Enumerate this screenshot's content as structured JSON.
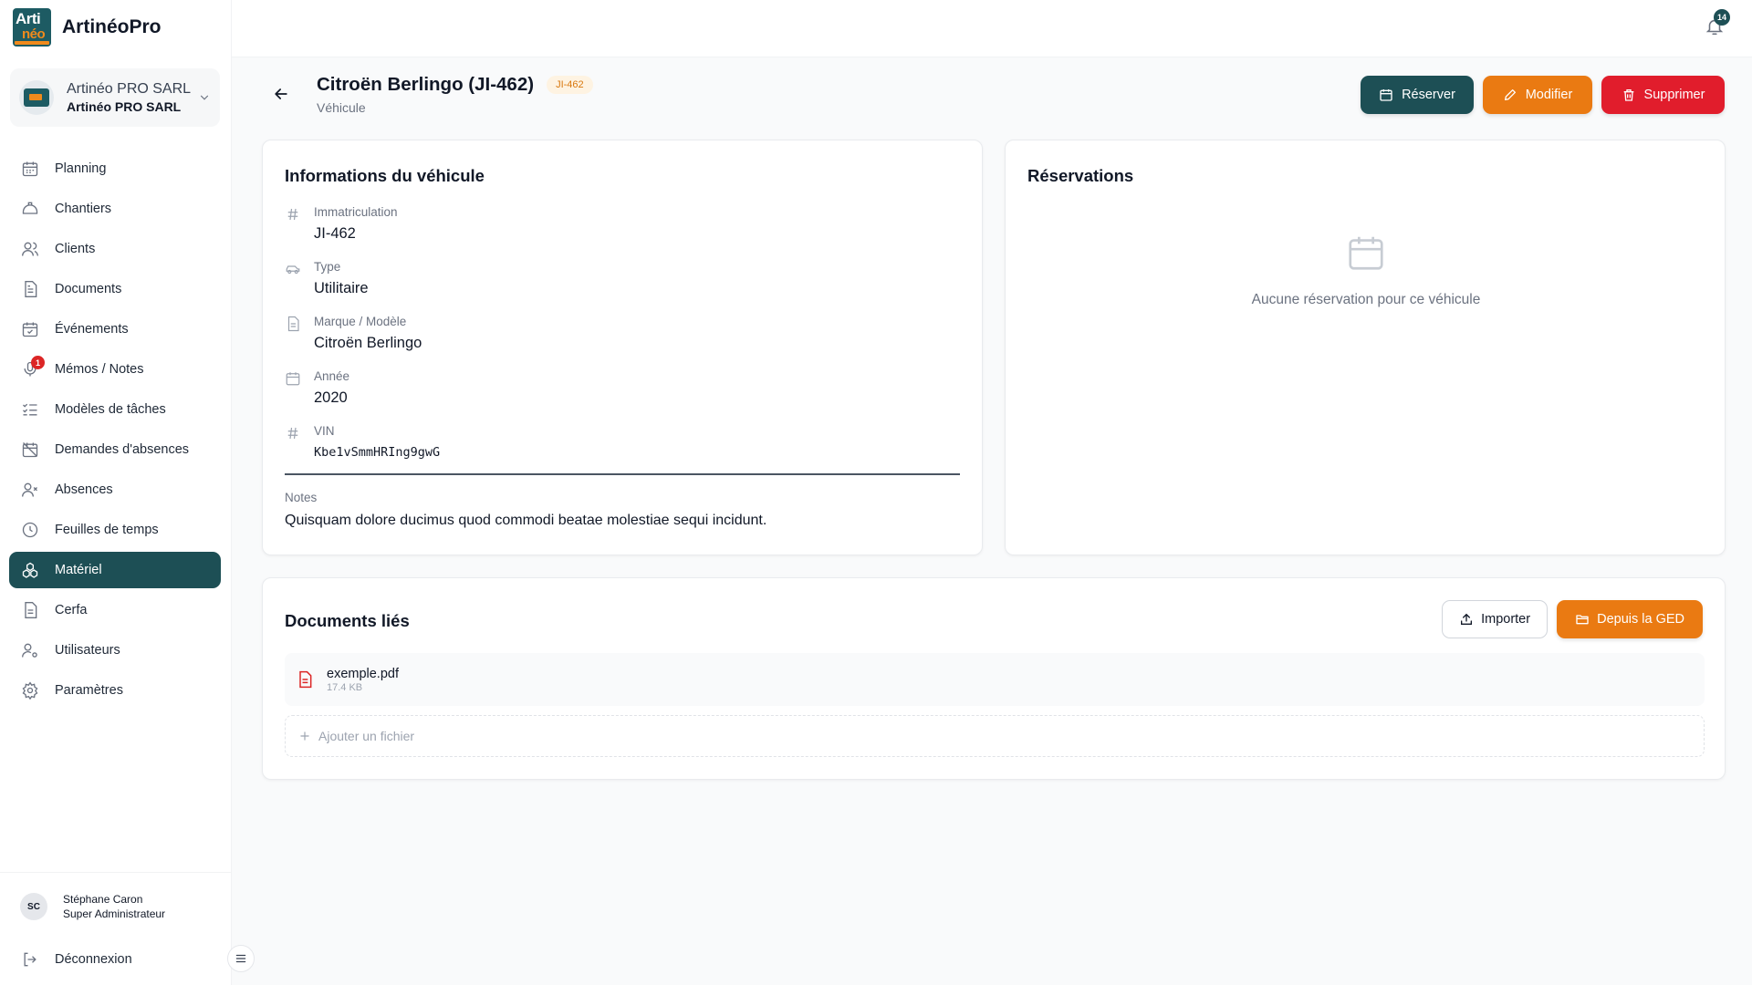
{
  "app": {
    "logo_top": "Arti",
    "logo_bottom": "néo",
    "name": "ArtinéoPro"
  },
  "company": {
    "name_top": "Artinéo PRO SARL",
    "name_bottom": "Artinéo PRO SARL"
  },
  "sidebar": {
    "items": [
      {
        "label": "Planning",
        "icon": "calendar-icon"
      },
      {
        "label": "Chantiers",
        "icon": "hard-hat-icon"
      },
      {
        "label": "Clients",
        "icon": "users-icon"
      },
      {
        "label": "Documents",
        "icon": "document-icon"
      },
      {
        "label": "Événements",
        "icon": "calendar-check-icon"
      },
      {
        "label": "Mémos / Notes",
        "icon": "microphone-icon",
        "badge": "1"
      },
      {
        "label": "Modèles de tâches",
        "icon": "list-checks-icon"
      },
      {
        "label": "Demandes d'absences",
        "icon": "calendar-off-icon"
      },
      {
        "label": "Absences",
        "icon": "user-x-icon"
      },
      {
        "label": "Feuilles de temps",
        "icon": "clock-icon"
      },
      {
        "label": "Matériel",
        "icon": "boxes-icon",
        "active": true
      },
      {
        "label": "Cerfa",
        "icon": "file-text-icon"
      },
      {
        "label": "Utilisateurs",
        "icon": "user-cog-icon"
      },
      {
        "label": "Paramètres",
        "icon": "settings-icon"
      }
    ]
  },
  "user": {
    "initials": "SC",
    "name": "Stéphane Caron",
    "role": "Super Administrateur"
  },
  "logout_label": "Déconnexion",
  "notifications": {
    "count": "14"
  },
  "page": {
    "title": "Citroën Berlingo (JI-462)",
    "badge": "JI-462",
    "subtitle": "Véhicule"
  },
  "actions": {
    "reserve": "Réserver",
    "edit": "Modifier",
    "delete": "Supprimer"
  },
  "info": {
    "title": "Informations du véhicule",
    "fields": [
      {
        "label": "Immatriculation",
        "value": "JI-462",
        "icon": "hash-icon"
      },
      {
        "label": "Type",
        "value": "Utilitaire",
        "icon": "car-icon"
      },
      {
        "label": "Marque / Modèle",
        "value": "Citroën Berlingo",
        "icon": "file-icon"
      },
      {
        "label": "Année",
        "value": "2020",
        "icon": "calendar-icon"
      },
      {
        "label": "VIN",
        "value": "Kbe1vSmmHRIng9gwG",
        "icon": "hash-icon"
      }
    ],
    "notes_label": "Notes",
    "notes_value": "Quisquam dolore ducimus quod commodi beatae molestiae sequi incidunt."
  },
  "reservations": {
    "title": "Réservations",
    "empty": "Aucune réservation pour ce véhicule"
  },
  "documents": {
    "title": "Documents liés",
    "import_label": "Importer",
    "ged_label": "Depuis la GED",
    "files": [
      {
        "name": "exemple.pdf",
        "size": "17.4 KB"
      }
    ],
    "add_label": "Ajouter un fichier"
  },
  "colors": {
    "primary": "#1d4f55",
    "accent": "#ea7a12",
    "danger": "#e11d2c"
  }
}
